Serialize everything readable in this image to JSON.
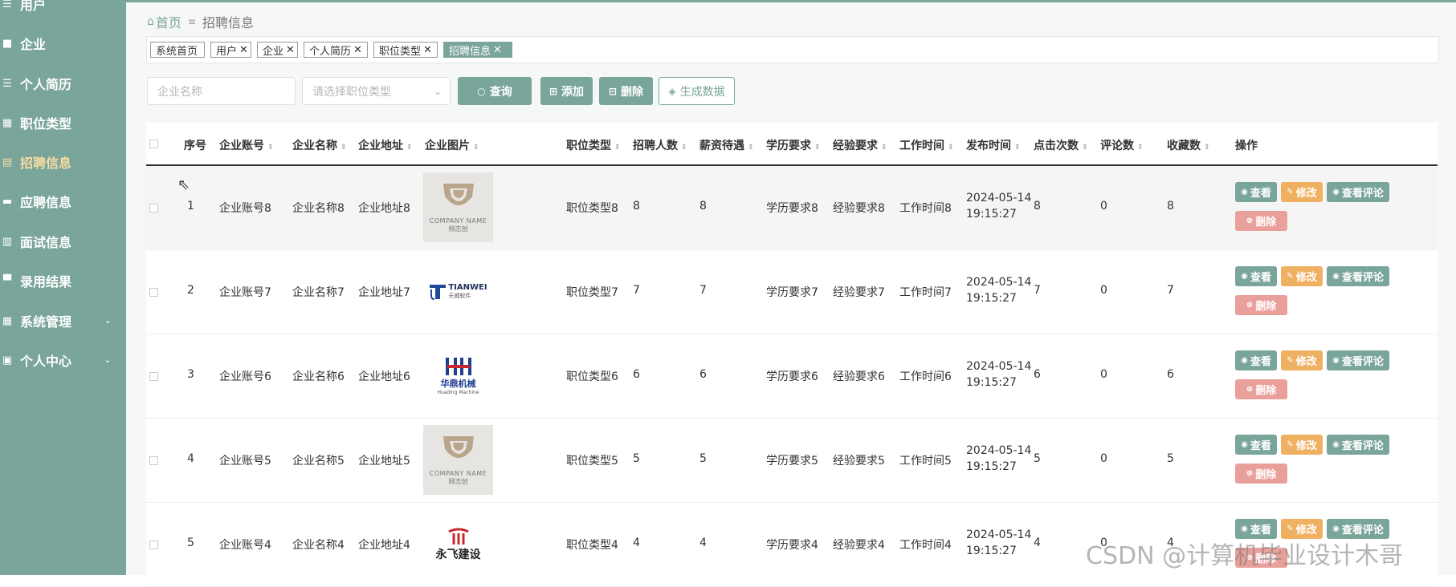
{
  "sidebar": {
    "items": [
      {
        "label": "用户",
        "icon": "list-icon"
      },
      {
        "label": "企业",
        "icon": "briefcase-icon"
      },
      {
        "label": "个人简历",
        "icon": "list-icon"
      },
      {
        "label": "职位类型",
        "icon": "grid-icon"
      },
      {
        "label": "招聘信息",
        "icon": "clipboard-icon",
        "active": true
      },
      {
        "label": "应聘信息",
        "icon": "chat-icon"
      },
      {
        "label": "面试信息",
        "icon": "document-icon"
      },
      {
        "label": "录用结果",
        "icon": "monitor-icon"
      },
      {
        "label": "系统管理",
        "icon": "grid-icon",
        "expandable": true
      },
      {
        "label": "个人中心",
        "icon": "window-icon",
        "expandable": true
      }
    ]
  },
  "breadcrumb": {
    "home": "首页",
    "current": "招聘信息"
  },
  "tabs": [
    {
      "label": "系统首页",
      "closable": false
    },
    {
      "label": "用户",
      "closable": true
    },
    {
      "label": "企业",
      "closable": true
    },
    {
      "label": "个人简历",
      "closable": true
    },
    {
      "label": "职位类型",
      "closable": true
    },
    {
      "label": "招聘信息",
      "closable": true,
      "active": true
    }
  ],
  "search": {
    "company_placeholder": "企业名称",
    "type_placeholder": "请选择职位类型",
    "query_label": "查询",
    "add_label": "添加",
    "delete_label": "删除",
    "generate_label": "生成数据"
  },
  "table": {
    "headers": [
      "序号",
      "企业账号",
      "企业名称",
      "企业地址",
      "企业图片",
      "职位类型",
      "招聘人数",
      "薪资待遇",
      "学历要求",
      "经验要求",
      "工作时间",
      "发布时间",
      "点击次数",
      "评论数",
      "收藏数",
      "操作"
    ],
    "rows": [
      {
        "no": "1",
        "account": "企业账号8",
        "name": "企业名称8",
        "address": "企业地址8",
        "logo": "company-name",
        "type": "职位类型8",
        "count": "8",
        "salary": "8",
        "edu": "学历要求8",
        "exp": "经验要求8",
        "worktime": "工作时间8",
        "date": "2024-05-14",
        "time": "19:15:27",
        "clicks": "8",
        "comments": "0",
        "favorites": "8"
      },
      {
        "no": "2",
        "account": "企业账号7",
        "name": "企业名称7",
        "address": "企业地址7",
        "logo": "tianwei",
        "type": "职位类型7",
        "count": "7",
        "salary": "7",
        "edu": "学历要求7",
        "exp": "经验要求7",
        "worktime": "工作时间7",
        "date": "2024-05-14",
        "time": "19:15:27",
        "clicks": "7",
        "comments": "0",
        "favorites": "7"
      },
      {
        "no": "3",
        "account": "企业账号6",
        "name": "企业名称6",
        "address": "企业地址6",
        "logo": "huading",
        "type": "职位类型6",
        "count": "6",
        "salary": "6",
        "edu": "学历要求6",
        "exp": "经验要求6",
        "worktime": "工作时间6",
        "date": "2024-05-14",
        "time": "19:15:27",
        "clicks": "6",
        "comments": "0",
        "favorites": "6"
      },
      {
        "no": "4",
        "account": "企业账号5",
        "name": "企业名称5",
        "address": "企业地址5",
        "logo": "company-name",
        "type": "职位类型5",
        "count": "5",
        "salary": "5",
        "edu": "学历要求5",
        "exp": "经验要求5",
        "worktime": "工作时间5",
        "date": "2024-05-14",
        "time": "19:15:27",
        "clicks": "5",
        "comments": "0",
        "favorites": "5"
      },
      {
        "no": "5",
        "account": "企业账号4",
        "name": "企业名称4",
        "address": "企业地址4",
        "logo": "yongfei",
        "type": "职位类型4",
        "count": "4",
        "salary": "4",
        "edu": "学历要求4",
        "exp": "经验要求4",
        "worktime": "工作时间4",
        "date": "2024-05-14",
        "time": "19:15:27",
        "clicks": "4",
        "comments": "0",
        "favorites": "4"
      }
    ],
    "actions": {
      "view": "查看",
      "edit": "修改",
      "view_comments": "查看评论",
      "delete": "删除"
    }
  },
  "logos": {
    "company_name_text": "COMPANY NAME",
    "company_name_sub": "频志创",
    "tianwei_text": "TIANWEI",
    "tianwei_sub": "天威软件",
    "huading_text": "华鼎机械",
    "huading_sub": "Huading Machine",
    "yongfei_text": "永飞建设"
  },
  "watermark": "CSDN @计算机毕业设计木哥",
  "colors": {
    "accent": "#7aa59b",
    "edit": "#f0b062",
    "delete": "#eaa09a",
    "active_menu": "#f6dca4"
  }
}
